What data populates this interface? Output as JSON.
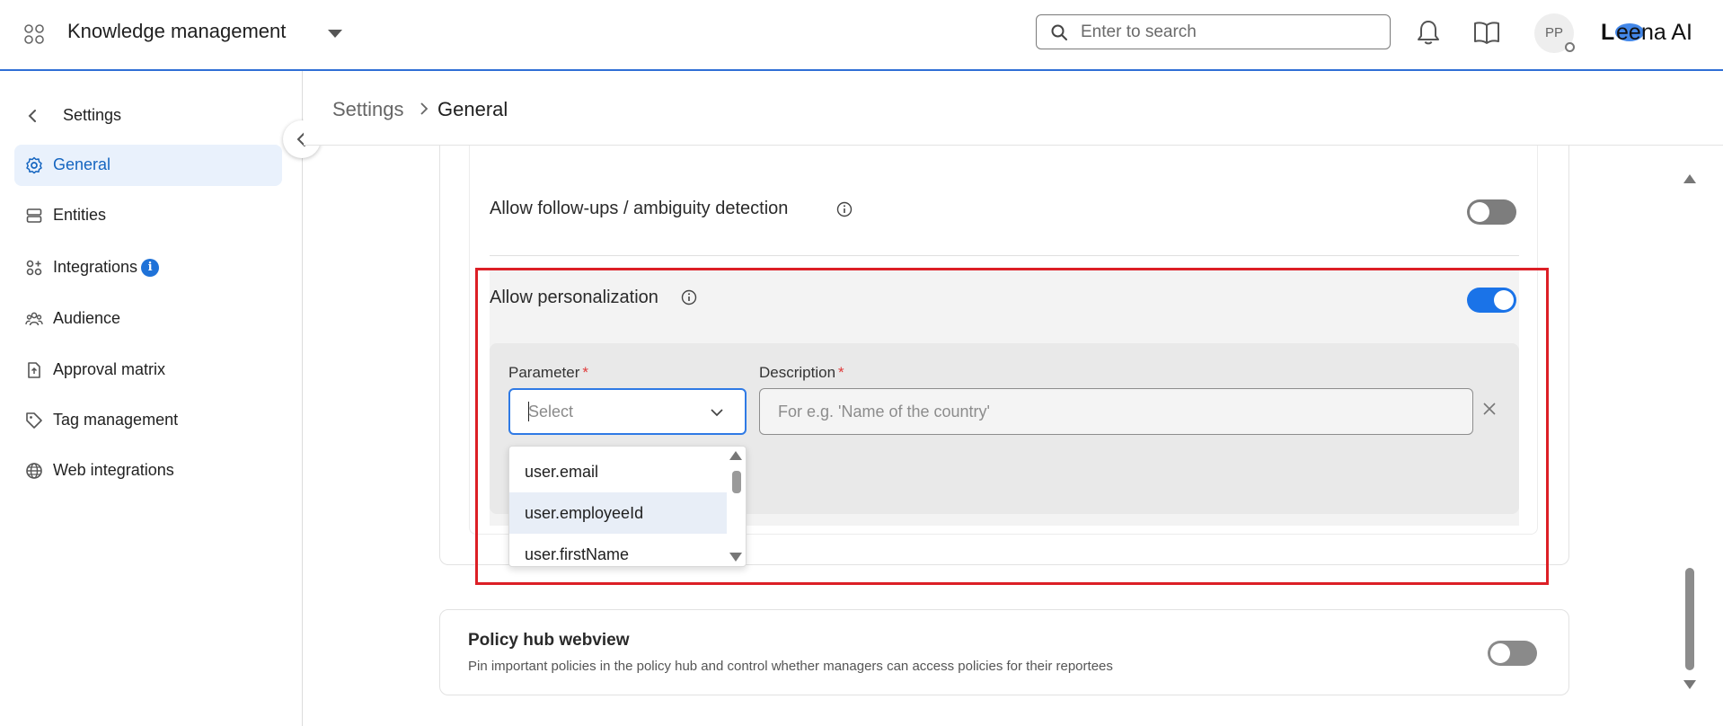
{
  "header": {
    "app_title": "Knowledge management",
    "search_placeholder": "Enter to search",
    "avatar_initials": "PP",
    "brand": "Leena AI",
    "accent_color": "#2f6fd6"
  },
  "sidebar": {
    "back_label": "Settings",
    "items": [
      {
        "label": "General",
        "icon": "gear-icon",
        "active": true
      },
      {
        "label": "Entities",
        "icon": "database-icon",
        "active": false
      },
      {
        "label": "Integrations",
        "icon": "integrations-icon",
        "active": false,
        "badge": "i"
      },
      {
        "label": "Audience",
        "icon": "users-icon",
        "active": false
      },
      {
        "label": "Approval matrix",
        "icon": "file-upload-icon",
        "active": false
      },
      {
        "label": "Tag management",
        "icon": "tag-icon",
        "active": false
      },
      {
        "label": "Web integrations",
        "icon": "globe-icon",
        "active": false
      }
    ]
  },
  "breadcrumb": {
    "parent": "Settings",
    "current": "General"
  },
  "settings": {
    "followups": {
      "label": "Allow follow-ups / ambiguity detection",
      "enabled": false
    },
    "personalization": {
      "label": "Allow personalization",
      "enabled": true,
      "parameter_label": "Parameter",
      "description_label": "Description",
      "required_mark": "*",
      "select_placeholder": "Select",
      "description_placeholder": "For e.g. 'Name of the country'",
      "options": [
        "user.email",
        "user.employeeId",
        "user.firstName"
      ],
      "hovered_option": "user.employeeId"
    },
    "policy_hub": {
      "title": "Policy hub webview",
      "description": "Pin important policies in the policy hub and control whether managers can access policies for their reportees",
      "enabled": false
    }
  },
  "colors": {
    "toggle_on": "#1a73e8",
    "toggle_off": "#7d7d7d",
    "highlight": "#dc1f26",
    "required": "#e03a3a"
  }
}
